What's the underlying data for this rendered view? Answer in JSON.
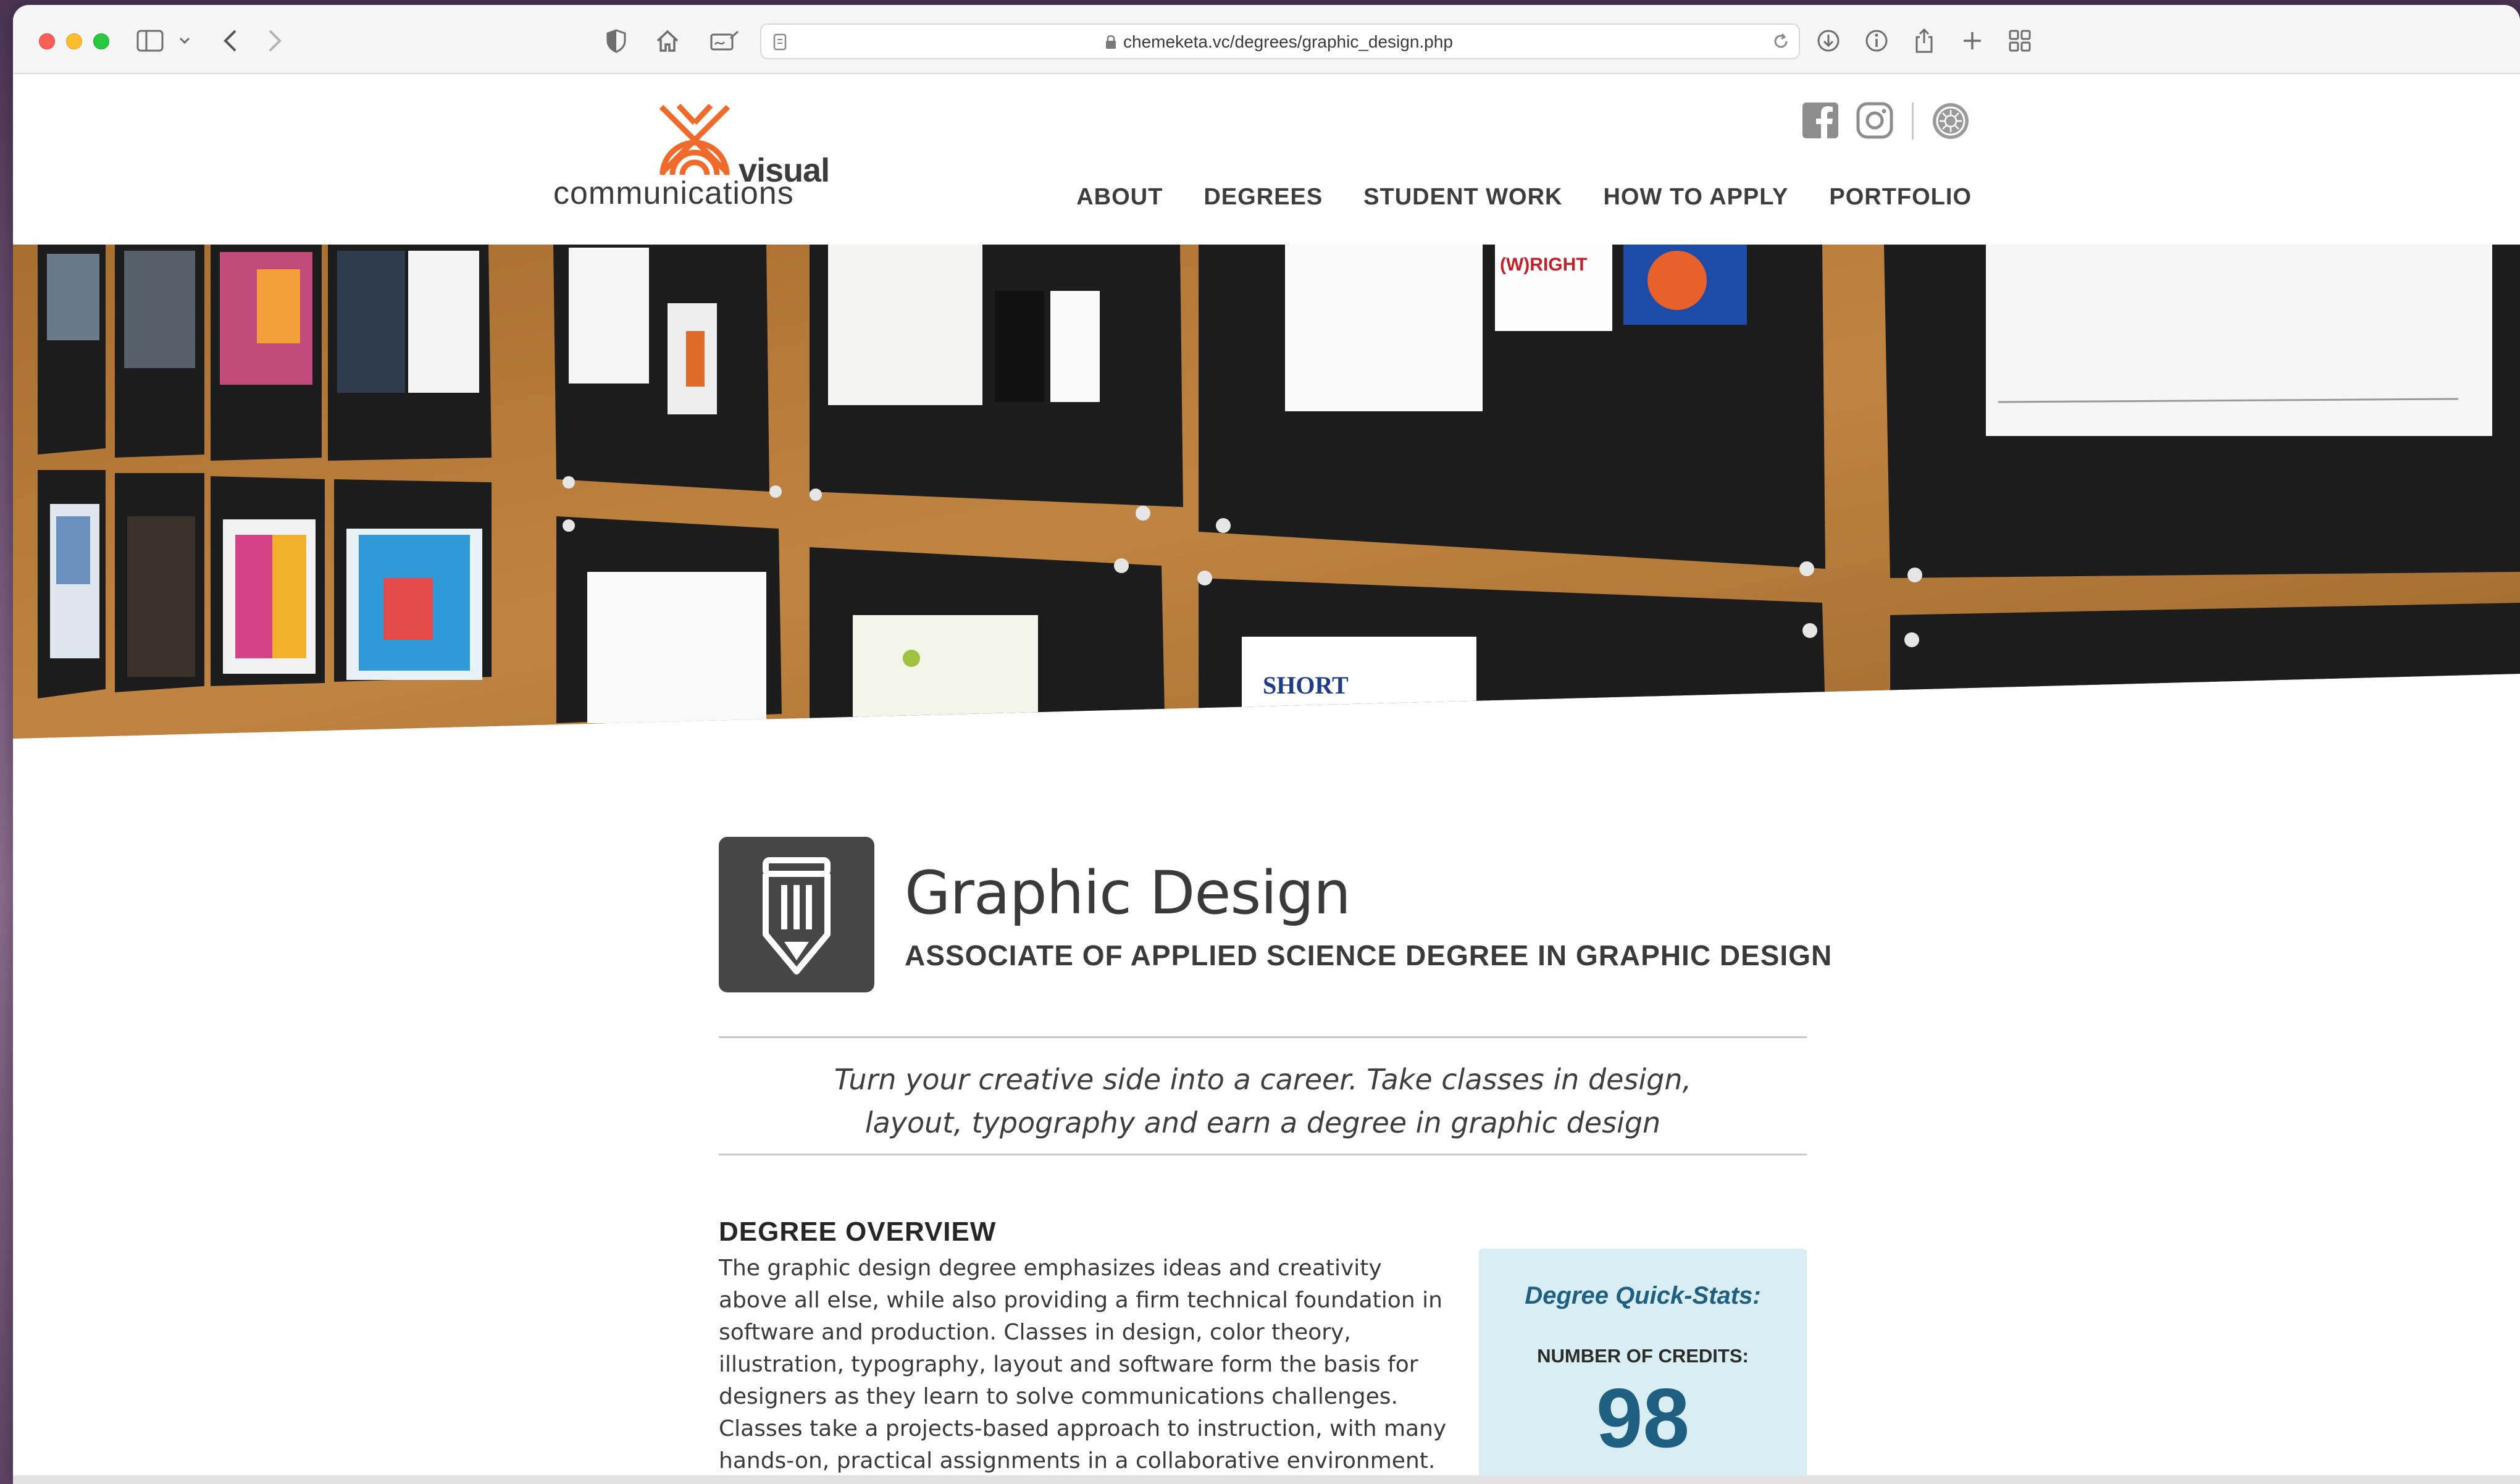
{
  "browser": {
    "url": "chemeketa.vc/degrees/graphic_design.php"
  },
  "logo": {
    "word1": "visual",
    "word2": "communications",
    "accent": "#ef6a2b"
  },
  "nav": {
    "items": [
      "ABOUT",
      "DEGREES",
      "STUDENT WORK",
      "HOW TO APPLY",
      "PORTFOLIO"
    ]
  },
  "social": {
    "icons": [
      "facebook-icon",
      "instagram-icon",
      "college-seal-icon"
    ]
  },
  "program": {
    "icon": "pencil-icon",
    "title": "Graphic Design",
    "subtitle": "ASSOCIATE OF APPLIED SCIENCE DEGREE IN GRAPHIC DESIGN",
    "tagline_line1": "Turn your creative side into a career. Take classes in design,",
    "tagline_line2": "layout, typography and earn a degree in graphic design"
  },
  "hero": {
    "board_texts": [
      "(W)RIGHT",
      "SHORT"
    ]
  },
  "overview": {
    "heading": "DEGREE OVERVIEW",
    "body": "The graphic design degree emphasizes ideas and creativity above all else, while also providing a firm technical foundation in software and production. Classes in design, color theory, illustration, typography, layout and software form the basis for designers as they learn to solve communications challenges. Classes take a projects-based approach to instruction, with many hands-on, practical assignments in a collaborative environment."
  },
  "quick_stats": {
    "title": "Degree Quick-Stats:",
    "credits_label": "NUMBER OF CREDITS:",
    "credits_value": "98",
    "bg": "#d9eef2",
    "accent": "#1f5f82"
  }
}
